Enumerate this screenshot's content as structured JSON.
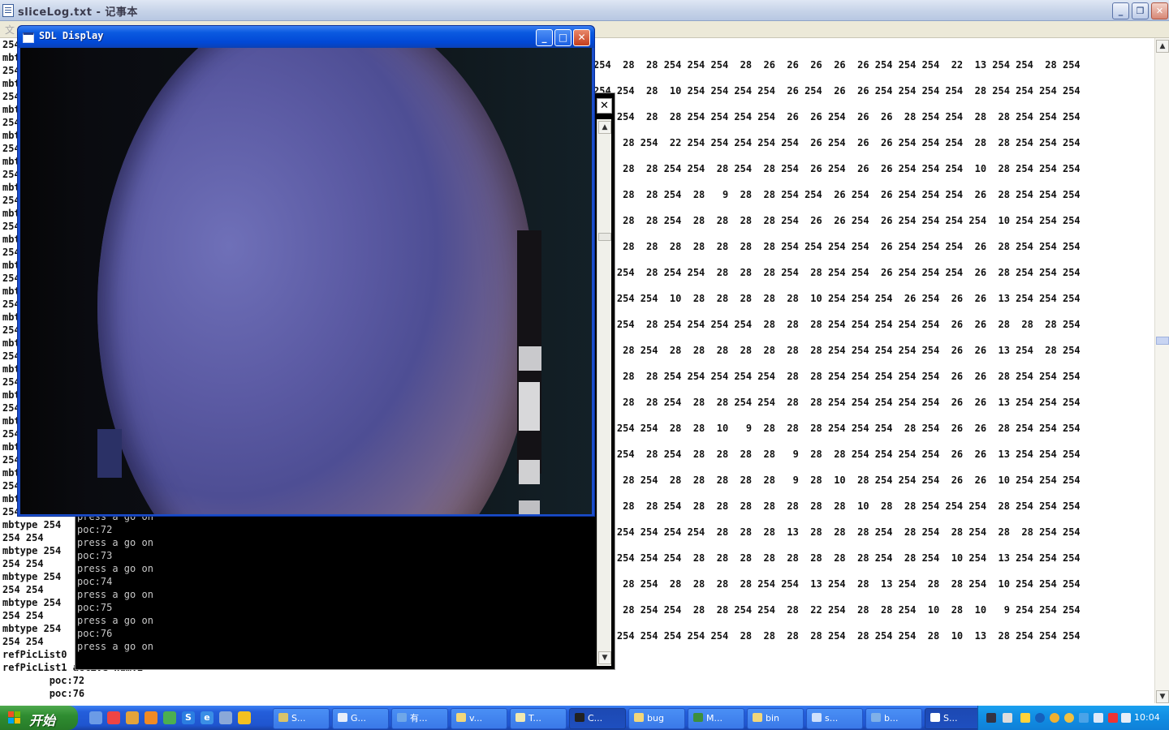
{
  "notepad": {
    "title": "sliceLog.txt - 记事本",
    "menu_first": "文",
    "left_lines": [
      "254",
      "mbt",
      "254",
      "mbt",
      "254",
      "mbt",
      "254",
      "mbt",
      "254",
      "mbt",
      "254",
      "mbt",
      "254",
      "mbt",
      "254",
      "mbt",
      "254",
      "mbt",
      "254",
      "mbt",
      "254",
      "mbt",
      "254",
      "mbt",
      "254",
      "mbt",
      "254",
      "mbt",
      "254",
      "mbt",
      "254",
      "mbt",
      "254",
      "mbt",
      "254",
      "mbt",
      "254",
      "mbtype 254",
      "254 254",
      "mbtype 254",
      "254 254",
      "mbtype 254",
      "254 254",
      "mbtype 254",
      "254 254",
      "mbtype 254",
      "254 254",
      "refPicList0",
      "refPicList1 active num:2",
      "        poc:72",
      "        poc:76"
    ],
    "right_rows": [
      "254  28  28 254 254 254  28  26  26  26  26  26 254 254 254  22  13 254 254  28 254",
      "254 254  28  10 254 254 254 254  26 254  26  26 254 254 254 254  28 254 254 254 254",
      "    254  28  28 254 254 254 254  26  26 254  26  26  28 254 254  28  28 254 254 254",
      "     28 254  22 254 254 254 254 254  26 254  26  26 254 254 254  28  28 254 254 254",
      "     28  28 254 254  28 254  28 254  26 254  26  26 254 254 254  10  28 254 254 254",
      "     28  28 254  28   9  28  28 254 254  26 254  26 254 254 254  26  28 254 254 254",
      "     28  28 254  28  28  28  28 254  26  26 254  26 254 254 254 254  10 254 254 254",
      "     28  28  28  28  28  28  28 254 254 254 254  26 254 254 254  26  28 254 254 254",
      "    254  28 254 254  28  28  28 254  28 254 254  26 254 254 254  26  28 254 254 254",
      "    254 254  10  28  28  28  28  28  10 254 254 254  26 254  26  26  13 254 254 254",
      "    254  28 254 254 254 254  28  28  28 254 254 254 254 254  26  26  28  28  28 254",
      "     28 254  28  28  28  28  28  28  28 254 254 254 254 254  26  26  13 254  28 254",
      "     28  28 254 254 254 254 254  28  28 254 254 254 254 254  26  26  28 254 254 254",
      "     28  28 254  28  28 254 254  28  28 254 254 254 254 254  26  26  13 254 254 254",
      "    254 254  28  28  10   9  28  28  28 254 254 254  28 254  26  26  28 254 254 254",
      "    254  28 254  28  28  28  28   9  28  28 254 254 254 254  26  26  13 254 254 254",
      "     28 254  28  28  28  28  28   9  28  10  28 254 254 254  26  26  10 254 254 254",
      "     28  28 254  28  28  28  28  28  28  28  10  28  28 254 254 254  28 254 254 254",
      "    254 254 254 254  28  28  28  13  28  28  28 254  28 254  28 254  28  28 254 254",
      "    254 254 254  28  28  28  28  28  28  28  28 254  28 254  10 254  13 254 254 254",
      "     28 254  28  28  28  28 254 254  13 254  28  13 254  28  28 254  10 254 254 254",
      "     28 254 254  28  28 254 254  28  22 254  28  28 254  10  28  10   9 254 254 254",
      "    254 254 254 254 254  28  28  28  28 254  28 254 254  28  10  13  28 254 254 254"
    ]
  },
  "console": {
    "lines": [
      "press a go on",
      "poc:72",
      "press a go on",
      "poc:73",
      "press a go on",
      "poc:74",
      "press a go on",
      "poc:75",
      "press a go on",
      "poc:76",
      "press a go on"
    ],
    "close_glyph": "✕"
  },
  "sdl": {
    "title": "SDL Display"
  },
  "taskbar": {
    "start_label": "开始",
    "tasks": [
      {
        "label": "S...",
        "icon": "app-icon",
        "color": "#d9c36a"
      },
      {
        "label": "G...",
        "icon": "chat-icon",
        "color": "#e8eef9"
      },
      {
        "label": "有...",
        "icon": "dictionary-icon",
        "color": "#6fa7e8"
      },
      {
        "label": "v...",
        "icon": "folder-icon",
        "color": "#f2d77a"
      },
      {
        "label": "T...",
        "icon": "editor-icon",
        "color": "#f1e9b0"
      },
      {
        "label": "C...",
        "icon": "console-icon",
        "color": "#222222"
      },
      {
        "label": "bug",
        "icon": "folder-icon",
        "color": "#f2d77a"
      },
      {
        "label": "M...",
        "icon": "excel-icon",
        "color": "#3d8f3d"
      },
      {
        "label": "bin",
        "icon": "folder-icon",
        "color": "#f2d77a"
      },
      {
        "label": "s...",
        "icon": "notepad-icon",
        "color": "#cfe0fb"
      },
      {
        "label": "b...",
        "icon": "browser-icon",
        "color": "#7fb0e8"
      },
      {
        "label": "S...",
        "icon": "window-icon",
        "color": "#ffffff"
      }
    ],
    "clock": "10:04"
  }
}
